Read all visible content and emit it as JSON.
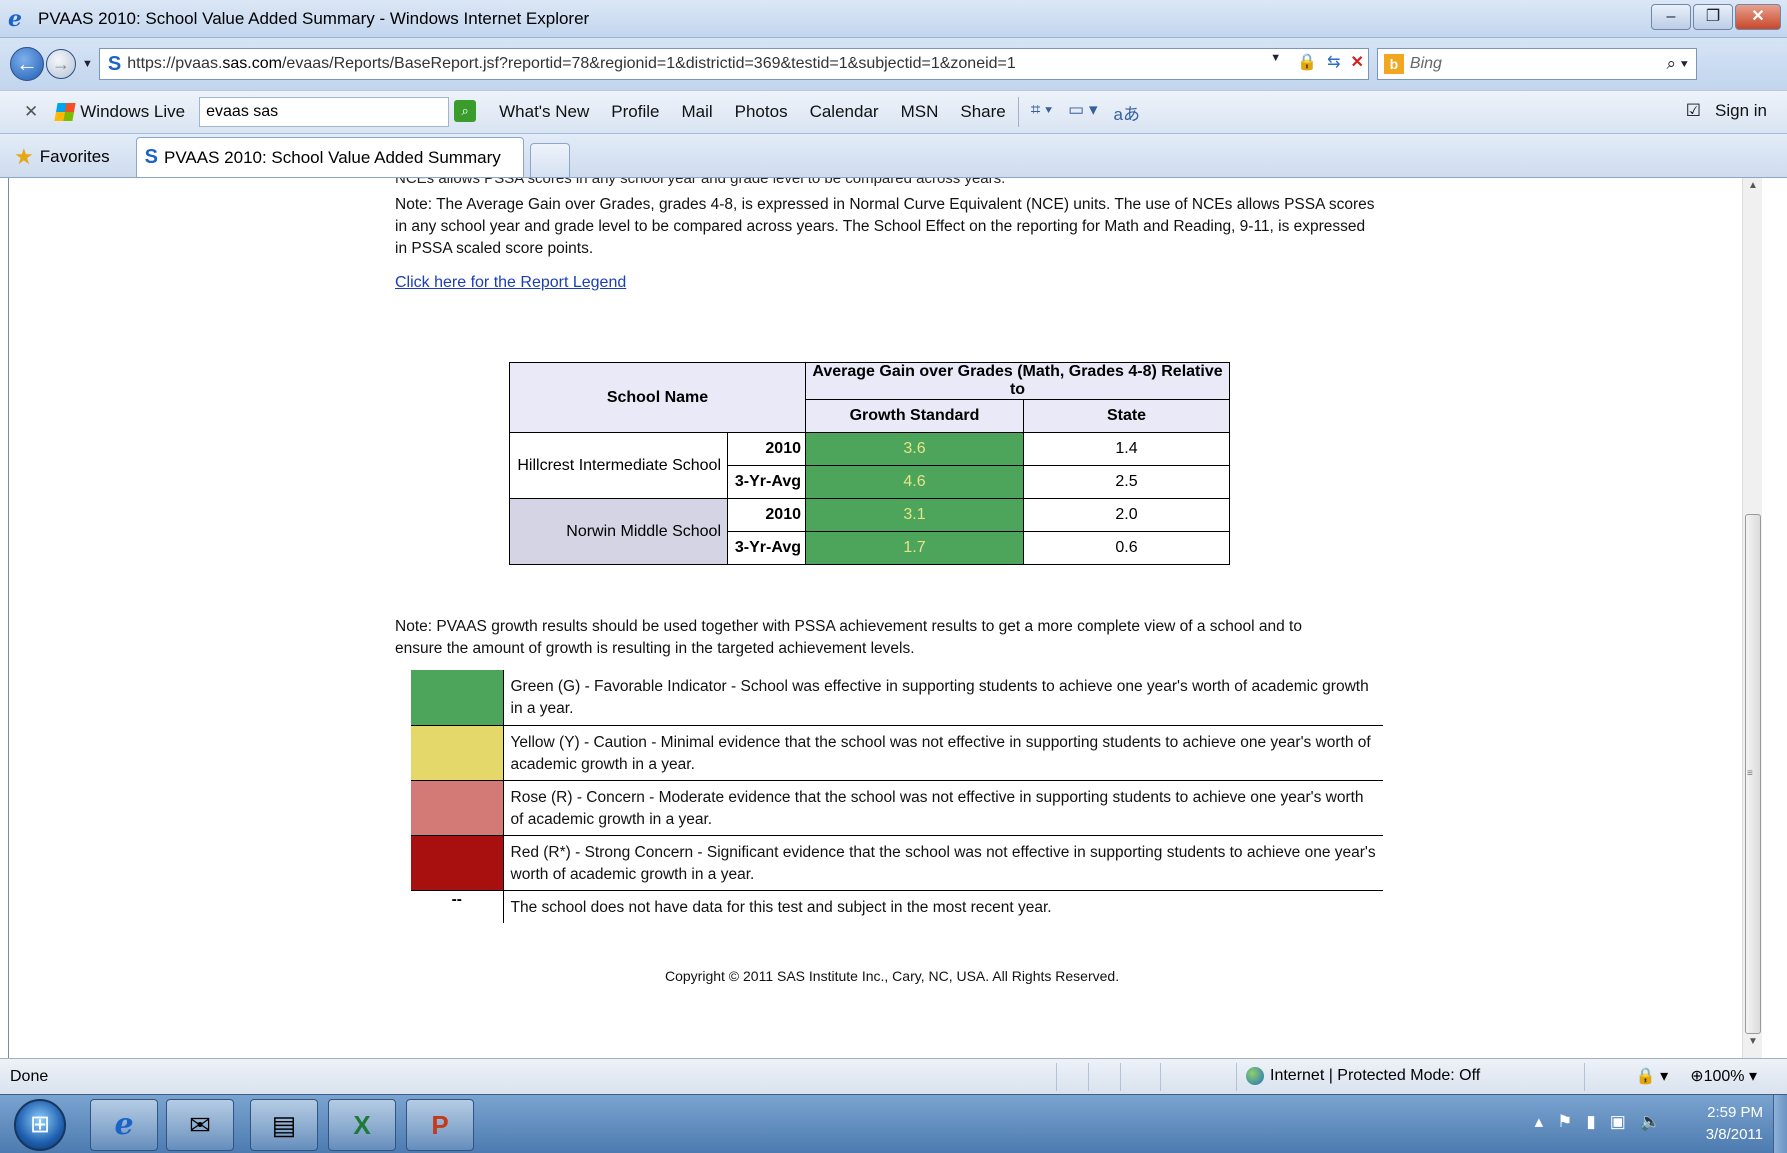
{
  "window": {
    "title": "PVAAS 2010: School Value Added Summary - Windows Internet Explorer"
  },
  "address": {
    "url_prefix": "https://pvaas.",
    "url_domain": "sas.com",
    "url_rest": "/evaas/Reports/BaseReport.jsf?reportid=78&regionid=1&districtid=369&testid=1&subjectid=1&zoneid=1",
    "search_placeholder": "Bing"
  },
  "toolbar": {
    "windows_live": "Windows Live",
    "search_value": "evaas sas",
    "links": [
      "What's New",
      "Profile",
      "Mail",
      "Photos",
      "Calendar",
      "MSN",
      "Share"
    ],
    "sign_in": "Sign in"
  },
  "favorites": {
    "label": "Favorites",
    "tab_title": "PVAAS 2010: School Value Added Summary"
  },
  "content": {
    "clipped_line": "NCEs allows PSSA scores in any school year and grade level to be compared across years.",
    "note1": "Note: The Average Gain over Grades, grades 4-8, is expressed in Normal Curve Equivalent (NCE) units. The use of NCEs allows PSSA scores in any school year and grade level to be compared across years. The School Effect on the reporting for Math and Reading, 9-11, is expressed in PSSA scaled score points.",
    "legend_link": "Click here for the Report Legend",
    "table": {
      "col_school": "School Name",
      "col_group": "Average Gain over Grades (Math, Grades 4-8) Relative to",
      "col_growth": "Growth Standard",
      "col_state": "State",
      "rows": [
        {
          "school": "Hillcrest Intermediate School",
          "r1": {
            "label": "2010",
            "growth": "3.6",
            "state": "1.4"
          },
          "r2": {
            "label": "3-Yr-Avg",
            "growth": "4.6",
            "state": "2.5"
          }
        },
        {
          "school": "Norwin Middle School",
          "r1": {
            "label": "2010",
            "growth": "3.1",
            "state": "2.0"
          },
          "r2": {
            "label": "3-Yr-Avg",
            "growth": "1.7",
            "state": "0.6"
          }
        }
      ]
    },
    "note2": "Note: PVAAS growth results should be used together with PSSA achievement results to get a more complete view of a school and to ensure the amount of growth is resulting in the targeted achievement levels.",
    "legend": [
      {
        "color": "#4ca55b",
        "text": "Green (G) - Favorable Indicator - School was effective in supporting students to achieve one year's worth of academic growth in a year."
      },
      {
        "color": "#e4d86a",
        "text": "Yellow (Y) - Caution - Minimal evidence that the school was not effective in supporting students to achieve one year's worth of academic growth in a year."
      },
      {
        "color": "#d37a76",
        "text": "Rose (R) - Concern - Moderate evidence that the school was not effective in supporting students to achieve one year's worth of academic growth in a year."
      },
      {
        "color": "#a81010",
        "text": "Red (R*) - Strong Concern - Significant evidence that the school was not effective in supporting students to achieve one year's worth of academic growth in a year."
      }
    ],
    "nodata_symbol": "--",
    "nodata_text": "The school does not have data for this test and subject in the most recent year.",
    "copyright": "Copyright © 2011 SAS Institute Inc., Cary, NC, USA. All Rights Reserved."
  },
  "status": {
    "done": "Done",
    "zone": "Internet | Protected Mode: Off",
    "zoom": "100%"
  },
  "taskbar": {
    "time": "2:59 PM",
    "date": "3/8/2011"
  }
}
